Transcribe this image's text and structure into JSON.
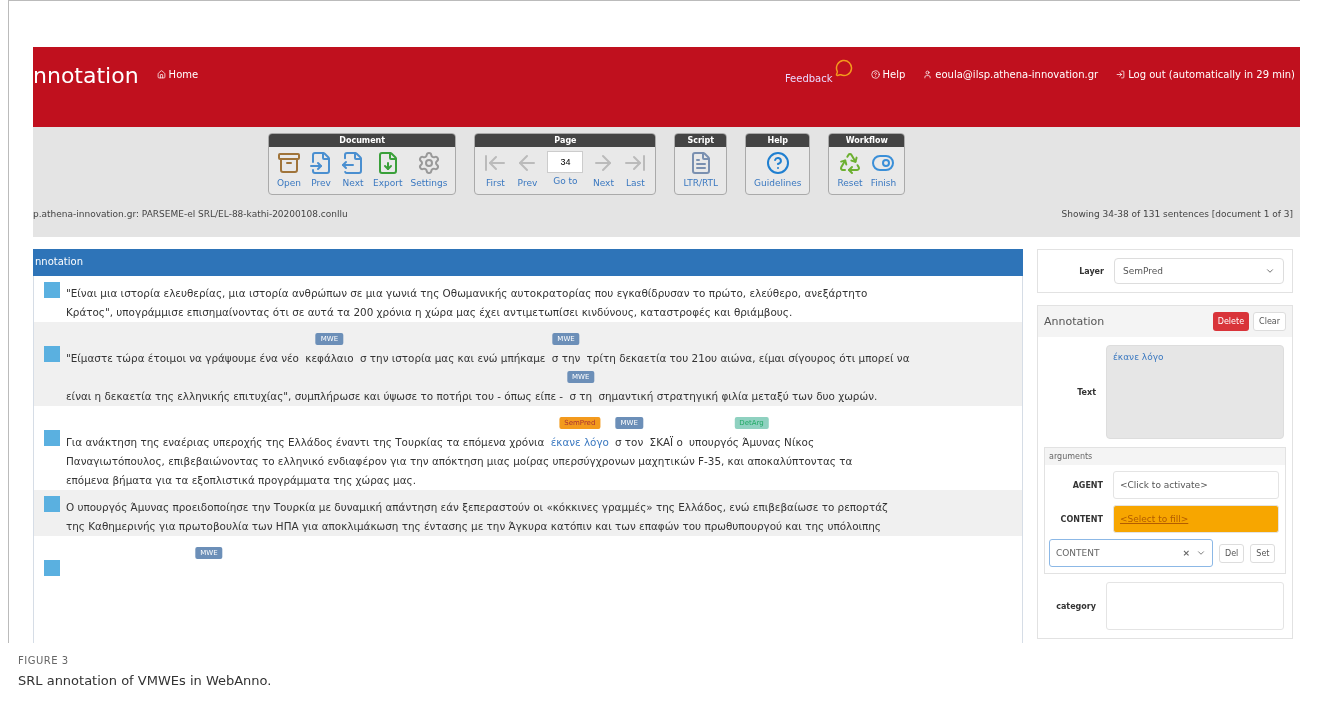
{
  "header": {
    "title": "nnotation",
    "home": "Home",
    "feedback": "Feedback",
    "help": "Help",
    "user": "eoula@ilsp.athena-innovation.gr",
    "logout": "Log out (automatically in 29 min)"
  },
  "toolbar": {
    "groups": [
      {
        "title": "Document",
        "buttons": [
          {
            "kind": "open",
            "label": "Open"
          },
          {
            "kind": "prev",
            "label": "Prev"
          },
          {
            "kind": "next",
            "label": "Next"
          },
          {
            "kind": "export",
            "label": "Export"
          },
          {
            "kind": "settings",
            "label": "Settings"
          }
        ]
      },
      {
        "title": "Page",
        "buttons": [
          {
            "kind": "first",
            "label": "First"
          },
          {
            "kind": "back",
            "label": "Prev"
          },
          {
            "kind": "goto",
            "label": "Go to",
            "value": "34"
          },
          {
            "kind": "forward",
            "label": "Next"
          },
          {
            "kind": "last",
            "label": "Last"
          }
        ]
      },
      {
        "title": "Script",
        "buttons": [
          {
            "kind": "script",
            "label": "LTR/RTL"
          }
        ]
      },
      {
        "title": "Help",
        "buttons": [
          {
            "kind": "help",
            "label": "Guidelines"
          }
        ]
      },
      {
        "title": "Workflow",
        "buttons": [
          {
            "kind": "reset",
            "label": "Reset"
          },
          {
            "kind": "finish",
            "label": "Finish"
          }
        ]
      }
    ]
  },
  "breadcrumb": "p.athena-innovation.gr: PARSEME-el SRL/EL-88-kathi-20200108.conllu",
  "sentence_range": "Showing 34-38 of 131 sentences [document 1 of 3]",
  "panel_title": "nnotation",
  "sentences": [
    {
      "lines": [
        [
          {
            "text": "\"Είναι μια ιστορία ελευθερίας, μια ιστορία ανθρώπων σε μια γωνιά της Οθωμανικής αυτοκρατορίας που εγκαθίδρυσαν το πρώτο, ελεύθερο, ανεξάρτητο"
          }
        ],
        [
          {
            "text": "Κράτος\", υπογράμμισε επισημαίνοντας ότι σε αυτά τα 200 χρόνια η χώρα μας έχει αντιμετωπίσει κινδύνους, καταστροφές και θριάμβους."
          }
        ]
      ]
    },
    {
      "lines": [
        [
          {
            "text": "\"Είμαστε τώρα έτοιμοι να γράψουμε ένα νέο "
          },
          {
            "text": "κεφάλαιο",
            "tag": "MWE",
            "kind": "mwe"
          },
          {
            "text": " σ την ιστορία μας και ενώ μπήκαμε "
          },
          {
            "text": "σ την",
            "tag": "MWE",
            "kind": "mwe"
          },
          {
            "text": " τρίτη δεκαετία του 21ου αιώνα, είμαι σίγουρος ότι μπορεί να"
          }
        ],
        [
          {
            "text": "είναι η δεκαετία της ελληνικής επιτυχίας\", συμπλήρωσε και ύψωσε το ποτήρι του - όπως είπε - "
          },
          {
            "text": "σ τη",
            "tag": "MWE",
            "kind": "mwe"
          },
          {
            "text": " σημαντική στρατηγική φιλία μεταξύ των δυο χωρών."
          }
        ]
      ]
    },
    {
      "lines": [
        [
          {
            "text": "Για ανάκτηση της εναέριας υπεροχής της Ελλάδος έναντι της Τουρκίας τα επόμενα χρόνια "
          },
          {
            "text": "έκανε λόγο",
            "tag": "SemPred",
            "kind": "pred",
            "selected": true
          },
          {
            "text": "σ τον",
            "tag": "MWE",
            "kind": "mwe"
          },
          {
            "text": " ΣΚΑΪ ο "
          },
          {
            "text": "υπουργός Άμυνας Νίκος",
            "tag": "DetArg",
            "kind": "arg"
          }
        ],
        [
          {
            "text": "Παναγιωτόπουλος, επιβεβαιώνοντας το ελληνικό ενδιαφέρον για την απόκτηση μιας μοίρας υπερσύγχρονων μαχητικών F-35, και αποκαλύπτοντας τα"
          }
        ],
        [
          {
            "text": "επόμενα βήματα για τα εξοπλιστικά προγράμματα της χώρας μας."
          }
        ]
      ]
    },
    {
      "lines": [
        [
          {
            "text": "Ο υπουργός Άμυνας προειδοποίησε την Τουρκία με δυναμική απάντηση εάν ξεπεραστούν οι «κόκκινες γραμμές» της Ελλάδος, ενώ επιβεβαίωσε το ρεπορτάζ"
          }
        ],
        [
          {
            "text": "της Καθημερινής για πρωτοβουλία των ΗΠΑ για αποκλιμάκωση της έντασης με την Άγκυρα κατόπιν και των επαφών του πρωθυπουργού και της υπόλοιπης"
          }
        ]
      ]
    },
    {
      "lines": [
        [
          {
            "tag": "MWE",
            "kind": "mwe"
          }
        ]
      ]
    }
  ],
  "side": {
    "layer_label": "Layer",
    "layer_value": "SemPred",
    "annotation_title": "Annotation",
    "delete": "Delete",
    "clear": "Clear",
    "text_label": "Text",
    "text_value": "έκανε λόγο",
    "arguments_legend": "arguments",
    "arguments": [
      {
        "label": "AGENT",
        "value": "<Click to activate>",
        "selected": false
      },
      {
        "label": "CONTENT",
        "value": "<Select to fill>",
        "selected": true
      }
    ],
    "role_select": "CONTENT",
    "role_clear": "×",
    "role_del": "Del",
    "role_set": "Set",
    "category_label": "category"
  },
  "caption": {
    "label": "FIGURE 3",
    "text": "SRL annotation of VMWEs in WebAnno."
  }
}
